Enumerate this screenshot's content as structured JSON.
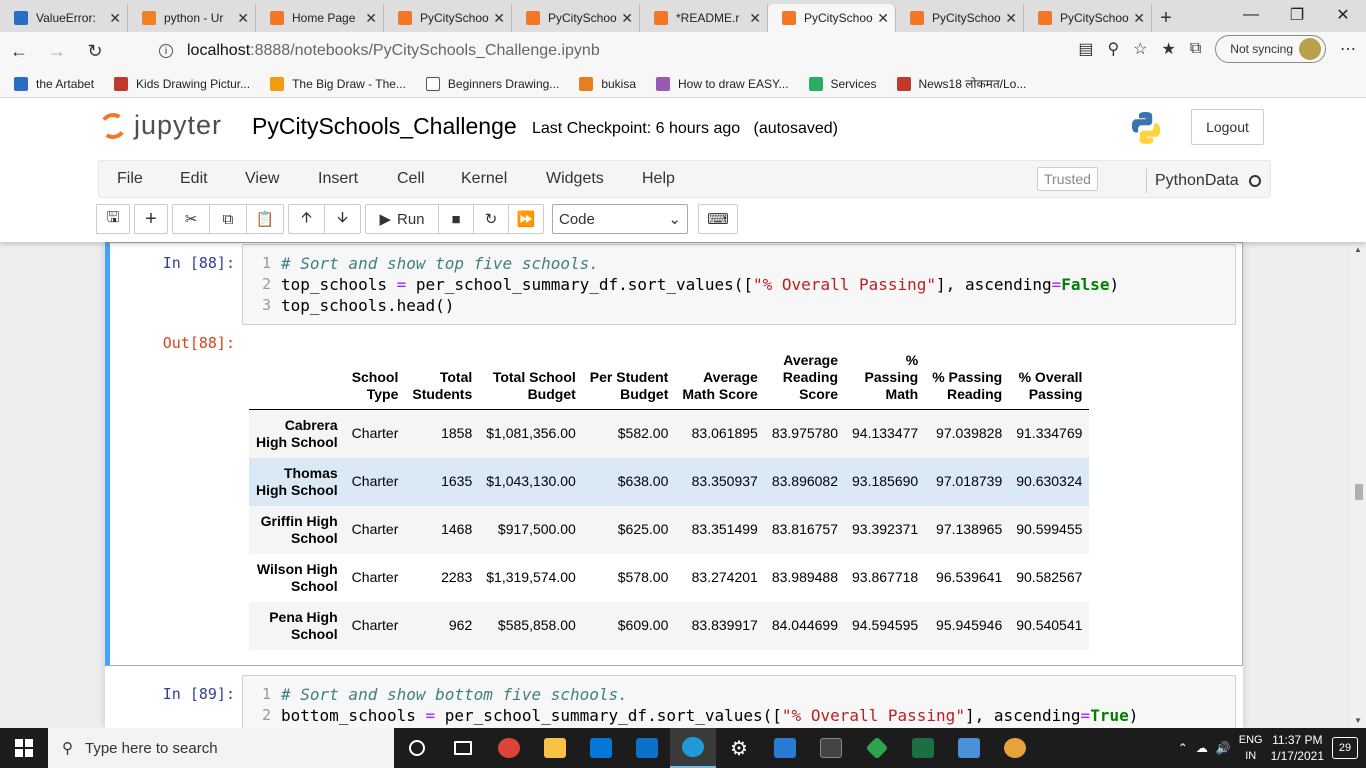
{
  "browser": {
    "tabs": [
      {
        "title": "ValueError:",
        "color": "#2b6cc4"
      },
      {
        "title": "python - Ur",
        "color": "#f48024"
      },
      {
        "title": "Home Page",
        "color": "#f37726"
      },
      {
        "title": "PyCitySchoo",
        "color": "#f37726"
      },
      {
        "title": "PyCitySchoo",
        "color": "#f37726"
      },
      {
        "title": "*README.r",
        "color": "#f37726"
      },
      {
        "title": "PyCitySchoo",
        "color": "#f37726",
        "active": true
      },
      {
        "title": "PyCitySchoo",
        "color": "#f37726"
      },
      {
        "title": "PyCitySchoo",
        "color": "#f37726"
      }
    ],
    "url_host": "localhost",
    "url_path": ":8888/notebooks/PyCitySchools_Challenge.ipynb",
    "sync_label": "Not syncing",
    "bookmarks": [
      {
        "label": "the Artabet",
        "color": "#2b6cc4"
      },
      {
        "label": "Kids Drawing Pictur...",
        "color": "#c0392b"
      },
      {
        "label": "The Big Draw - The...",
        "color": "#f39c12"
      },
      {
        "label": "Beginners Drawing...",
        "color": "#ffffff"
      },
      {
        "label": "bukisa",
        "color": "#e67e22"
      },
      {
        "label": "How to draw EASY...",
        "color": "#9b59b6"
      },
      {
        "label": "Services",
        "color": "#27ae60"
      },
      {
        "label": "News18 लोकमत/Lo...",
        "color": "#c0392b"
      }
    ]
  },
  "jupyter": {
    "logo_text": "jupyter",
    "notebook_title": "PyCitySchools_Challenge",
    "checkpoint": "Last Checkpoint: 6 hours ago",
    "autosave": "(autosaved)",
    "logout_label": "Logout",
    "menus": [
      "File",
      "Edit",
      "View",
      "Insert",
      "Cell",
      "Kernel",
      "Widgets",
      "Help"
    ],
    "trusted_label": "Trusted",
    "kernel_name": "PythonData",
    "run_label": "Run",
    "cell_type": "Code"
  },
  "cell88": {
    "in_prompt": "In [88]:",
    "out_prompt": "Out[88]:",
    "lines": [
      {
        "n": "1",
        "comment": "# Sort and show top five schools."
      },
      {
        "n": "2",
        "pre": "top_schools ",
        "op": "=",
        "mid": " per_school_summary_df.sort_values([",
        "str": "\"% Overall Passing\"",
        "post1": "], ascending",
        "op2": "=",
        "kw": "False",
        "post2": ")"
      },
      {
        "n": "3",
        "text": "top_schools.head()"
      }
    ]
  },
  "table": {
    "columns": [
      "School Type",
      "Total Students",
      "Total School Budget",
      "Per Student Budget",
      "Average Math Score",
      "Average Reading Score",
      "% Passing Math",
      "% Passing Reading",
      "% Overall Passing"
    ],
    "header_lines": [
      [
        "School",
        "Type"
      ],
      [
        "Total",
        "Students"
      ],
      [
        "Total School",
        "Budget"
      ],
      [
        "Per Student",
        "Budget"
      ],
      [
        "Average",
        "Math Score"
      ],
      [
        "Average",
        "Reading",
        "Score"
      ],
      [
        "%",
        "Passing",
        "Math"
      ],
      [
        "% Passing",
        "Reading"
      ],
      [
        "% Overall",
        "Passing"
      ]
    ],
    "rows": [
      {
        "school": [
          "Cabrera",
          "High School"
        ],
        "values": [
          "Charter",
          "1858",
          "$1,081,356.00",
          "$582.00",
          "83.061895",
          "83.975780",
          "94.133477",
          "97.039828",
          "91.334769"
        ]
      },
      {
        "school": [
          "Thomas",
          "High School"
        ],
        "values": [
          "Charter",
          "1635",
          "$1,043,130.00",
          "$638.00",
          "83.350937",
          "83.896082",
          "93.185690",
          "97.018739",
          "90.630324"
        ]
      },
      {
        "school": [
          "Griffin High",
          "School"
        ],
        "values": [
          "Charter",
          "1468",
          "$917,500.00",
          "$625.00",
          "83.351499",
          "83.816757",
          "93.392371",
          "97.138965",
          "90.599455"
        ]
      },
      {
        "school": [
          "Wilson High",
          "School"
        ],
        "values": [
          "Charter",
          "2283",
          "$1,319,574.00",
          "$578.00",
          "83.274201",
          "83.989488",
          "93.867718",
          "96.539641",
          "90.582567"
        ]
      },
      {
        "school": [
          "Pena High",
          "School"
        ],
        "values": [
          "Charter",
          "962",
          "$585,858.00",
          "$609.00",
          "83.839917",
          "84.044699",
          "94.594595",
          "95.945946",
          "90.540541"
        ]
      }
    ]
  },
  "cell89": {
    "in_prompt": "In [89]:",
    "lines": [
      {
        "n": "1",
        "comment": "# Sort and show bottom five schools."
      },
      {
        "n": "2",
        "pre": "bottom_schools ",
        "op": "=",
        "mid": " per_school_summary_df.sort_values([",
        "str": "\"% Overall Passing\"",
        "post1": "], ascending",
        "op2": "=",
        "kw": "True",
        "post2": ")"
      }
    ]
  },
  "taskbar": {
    "search_placeholder": "Type here to search",
    "lang_top": "ENG",
    "lang_bottom": "IN",
    "time": "11:37 PM",
    "date": "1/17/2021",
    "notifications": "29"
  }
}
